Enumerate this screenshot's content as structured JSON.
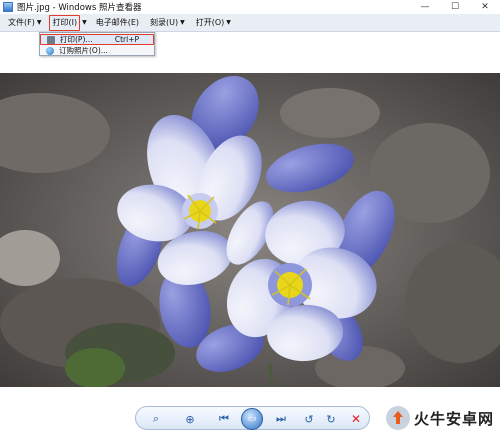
{
  "window": {
    "title": "图片.jpg - Windows 照片查看器",
    "minimize": "—",
    "maximize": "☐",
    "close": "✕"
  },
  "menubar": {
    "items": [
      {
        "label": "文件(F)"
      },
      {
        "label": "打印(I)"
      },
      {
        "label": "电子邮件(E)"
      },
      {
        "label": "刻录(U)"
      },
      {
        "label": "打开(O)"
      }
    ]
  },
  "print_menu": {
    "items": [
      {
        "label": "打印(P)...",
        "shortcut": "Ctrl+P",
        "icon": "printer-icon"
      },
      {
        "label": "订购照片(O)...",
        "shortcut": "",
        "icon": "globe-icon"
      }
    ]
  },
  "controls": {
    "zoom": "⌕",
    "fit": "⊕",
    "prev": "⏮",
    "slideshow": "▭",
    "next": "⏭",
    "rotate_ccw": "↺",
    "rotate_cw": "↻",
    "delete": "✕"
  },
  "watermark": {
    "text": "火牛安卓网"
  },
  "colors": {
    "menubar_bg": "#e9eef5",
    "highlight_border": "#e23b2e",
    "petal_blue": "#6e76cc",
    "petal_white": "#f2f3fb",
    "stamen_yellow": "#e8d61a"
  }
}
